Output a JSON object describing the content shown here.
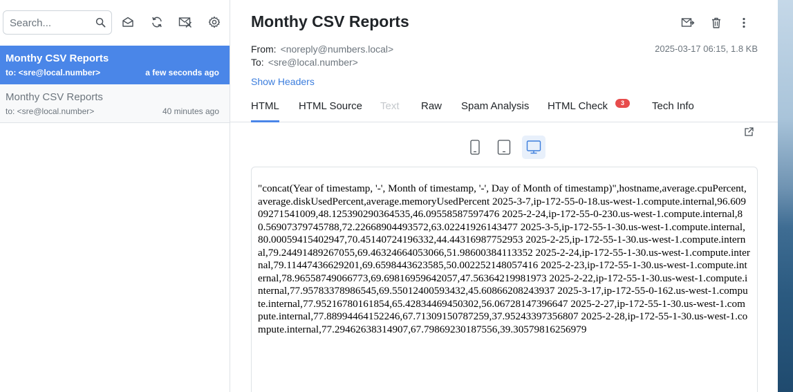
{
  "sidebar": {
    "search": {
      "placeholder": "Search..."
    },
    "toolbar_icons": [
      "mark-read-icon",
      "refresh-icon",
      "delete-all-icon",
      "settings-icon"
    ],
    "messages": [
      {
        "subject": "Monthy CSV Reports",
        "to": "to: <sre@local.number>",
        "time": "a few seconds ago",
        "state": "active"
      },
      {
        "subject": "Monthy CSV Reports",
        "to": "to: <sre@local.number>",
        "time": "40 minutes ago",
        "state": "read"
      }
    ]
  },
  "message": {
    "subject": "Monthy CSV Reports",
    "from_label": "From:",
    "from": "<noreply@numbers.local>",
    "to_label": "To:",
    "to": "<sre@local.number>",
    "meta": "2025-03-17 06:15, 1.8 KB",
    "show_headers": "Show Headers",
    "actions": [
      "forward-icon",
      "trash-icon",
      "more-vertical-icon"
    ]
  },
  "tabs": [
    {
      "label": "HTML",
      "state": "active"
    },
    {
      "label": "HTML Source",
      "state": "normal"
    },
    {
      "label": "Text",
      "state": "disabled"
    },
    {
      "label": "Raw",
      "state": "normal"
    },
    {
      "label": "Spam Analysis",
      "state": "normal"
    },
    {
      "label": "HTML Check",
      "state": "normal",
      "badge": "3"
    },
    {
      "label": "Tech Info",
      "state": "normal"
    }
  ],
  "preview": {
    "devices": [
      "phone-icon",
      "tablet-icon",
      "desktop-icon"
    ],
    "active_device": "desktop-icon",
    "body": "\"concat(Year of timestamp, '-', Month of timestamp, '-', Day of Month of timestamp)\",hostname,average.cpuPercent,average.diskUsedPercent,average.memoryUsedPercent 2025-3-7,ip-172-55-0-18.us-west-1.compute.internal,96.60909271541009,48.125390290364535,46.09558587597476 2025-2-24,ip-172-55-0-230.us-west-1.compute.internal,80.56907379745788,72.22668904493572,63.02241926143477 2025-3-5,ip-172-55-1-30.us-west-1.compute.internal,80.00059415402947,70.45140724196332,44.44316987752953 2025-2-25,ip-172-55-1-30.us-west-1.compute.internal,79.24491489267055,69.46324664053066,51.98600384113352 2025-2-24,ip-172-55-1-30.us-west-1.compute.internal,79.11447436629201,69.6598443623585,50.002252148057416 2025-2-23,ip-172-55-1-30.us-west-1.compute.internal,78.96558749066773,69.69816959642057,47.56364219981973 2025-2-22,ip-172-55-1-30.us-west-1.compute.internal,77.95783378986545,69.55012400593432,45.60866208243937 2025-3-17,ip-172-55-0-162.us-west-1.compute.internal,77.95216780161854,65.42834469450302,56.06728147396647 2025-2-27,ip-172-55-1-30.us-west-1.compute.internal,77.88994464152246,67.71309150787259,37.95243397356807 2025-2-28,ip-172-55-1-30.us-west-1.compute.internal,77.29462638314907,67.79869230187556,39.30579816256979"
  },
  "colors": {
    "accent": "#4a86e8",
    "link": "#3b7ddd",
    "badge": "#e74c4c",
    "border": "#dee2e6"
  }
}
